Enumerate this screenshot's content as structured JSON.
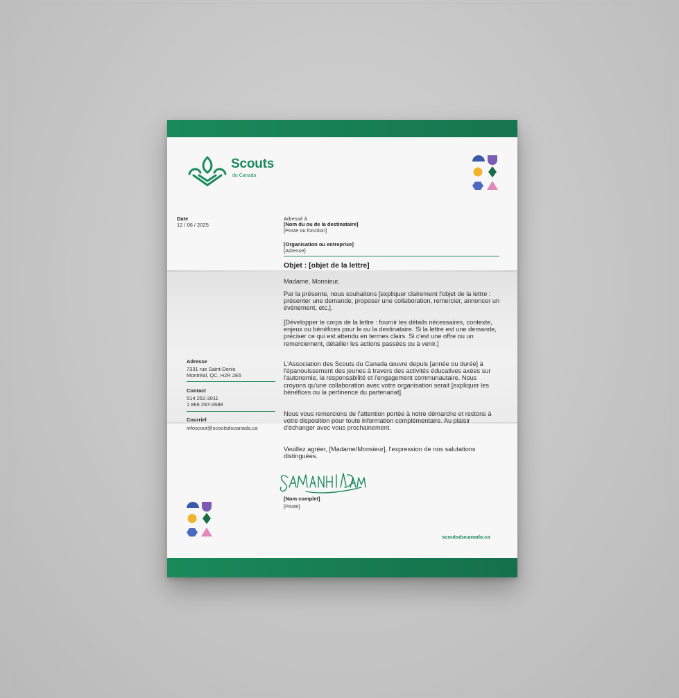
{
  "colors": {
    "brand_green": "#1a8a5b",
    "shape_navy": "#3a5ba9",
    "shape_purple": "#7b5cb3",
    "shape_yellow": "#f1b42f",
    "shape_green": "#1a6b47",
    "shape_blue": "#4c6bc0",
    "shape_pink": "#e386b8"
  },
  "logo": {
    "name": "Scouts",
    "sub": "du Canada",
    "icon": "fleur-de-lis-icon"
  },
  "date": {
    "label": "Date",
    "value": "12 / 06 / 2025"
  },
  "recipient": {
    "addressed_to": "Adressé à",
    "name": "[Nom du ou de la destinataire]",
    "position": "[Poste ou fonction]",
    "organization": "[Organisation ou entreprise]",
    "address": "[Adresse]"
  },
  "subject": "Objet : [objet de la lettre]",
  "body": {
    "salutation": "Madame, Monsieur,",
    "p1": "Par la présente, nous souhaitons [expliquer clairement l'objet de la lettre : présenter une demande, proposer une collaboration, remercier, annoncer un événement, etc.].",
    "p2": "[Développer le corps de la lettre : fournir les détails nécessaires, contexte, enjeux ou bénéfices pour le ou la destinataire. Si la lettre est une demande, préciser ce qui est attendu en termes clairs. Si c'est une offre ou un remerciement, détailler les actions passées ou à venir.]",
    "p3": "L'Association des Scouts du Canada œuvre depuis [année ou durée] à l'épanouissement des jeunes à travers des activités éducatives axées sur l'autonomie, la responsabilité et l'engagement communautaire. Nous croyons qu'une collaboration avec votre organisation serait [expliquer les bénéfices ou la pertinence du partenariat].",
    "p4": "Nous vous remercions de l'attention portée à notre démarche et restons à votre disposition pour toute information complémentaire. Au plaisir d'échanger avec vous prochainement.",
    "p5": "Veuillez agréer, [Madame/Monsieur], l'expression de nos salutations distinguées."
  },
  "signature": {
    "full_name": "[Nom complet]",
    "position": "[Poste]"
  },
  "sidebar": {
    "address_label": "Adresse",
    "address_line1": "7331 rue Saint-Denis",
    "address_line2": "Montréal, QC, H2R 2E5",
    "contact_label": "Contact",
    "phone1": "514 252-3011",
    "phone2": "1 866 297-2688",
    "email_label": "Courriel",
    "email": "infoscout@scoutsducanada.ca"
  },
  "website": "scoutsducanada.ca"
}
